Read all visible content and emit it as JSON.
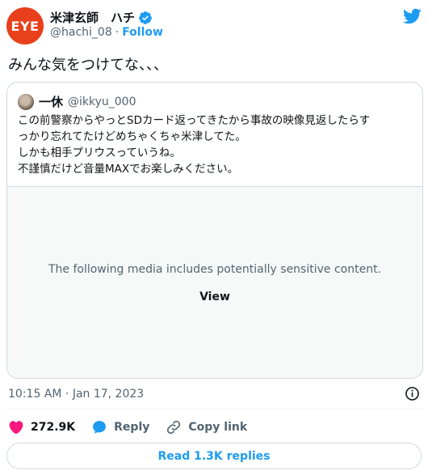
{
  "author": {
    "avatar_text": "EYE",
    "display_name": "米津玄師　ハチ",
    "handle": "@hachi_08",
    "separator": "·",
    "follow_label": "Follow"
  },
  "tweet": {
    "text": "みんな気をつけてな、、、"
  },
  "quoted": {
    "name": "一休",
    "handle": "@ikkyu_000",
    "lines": [
      "この前警察からやっとSDカード返ってきたから事故の映像見返したらす",
      "っかり忘れてたけどめちゃくちゃ米津してた。",
      "しかも相手プリウスっていうね。",
      "不謹慎だけど音量MAXでお楽しみください。"
    ],
    "media_notice": "The following media includes potentially sensitive content.",
    "media_view_label": "View"
  },
  "meta": {
    "time": "10:15 AM",
    "separator": "·",
    "date": "Jan 17, 2023"
  },
  "actions": {
    "like_count": "272.9K",
    "reply_label": "Reply",
    "copy_label": "Copy link"
  },
  "footer": {
    "replies_label": "Read 1.3K replies"
  },
  "colors": {
    "accent": "#1d9bf0",
    "like": "#f91880",
    "avatar_bg": "#e8401c"
  },
  "icons": [
    "twitter-bird-icon",
    "verified-badge-icon",
    "info-icon",
    "heart-icon",
    "reply-bubble-icon",
    "link-icon"
  ]
}
